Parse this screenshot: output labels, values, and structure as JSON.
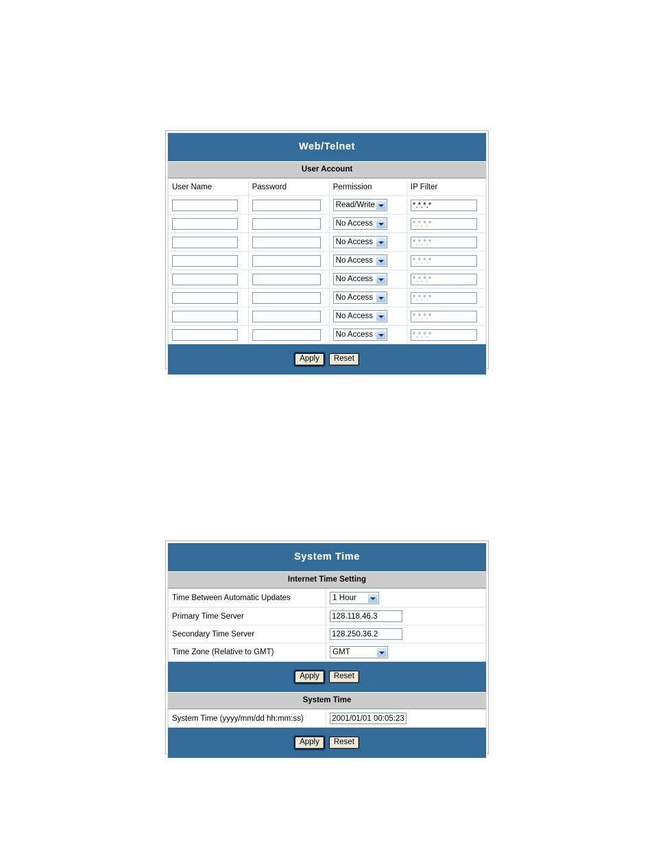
{
  "web_telnet": {
    "title": "Web/Telnet",
    "section": "User Account",
    "columns": [
      "User Name",
      "Password",
      "Permission",
      "IP Filter"
    ],
    "rows": [
      {
        "user": "",
        "password": "",
        "permission": "Read/Write",
        "ip_filter": "*.*.*.*",
        "disabled": false
      },
      {
        "user": "",
        "password": "",
        "permission": "No Access",
        "ip_filter": "*.*.*.*",
        "disabled": true
      },
      {
        "user": "",
        "password": "",
        "permission": "No Access",
        "ip_filter": "*.*.*.*",
        "disabled": true
      },
      {
        "user": "",
        "password": "",
        "permission": "No Access",
        "ip_filter": "*.*.*.*",
        "disabled": true
      },
      {
        "user": "",
        "password": "",
        "permission": "No Access",
        "ip_filter": "*.*.*.*",
        "disabled": true
      },
      {
        "user": "",
        "password": "",
        "permission": "No Access",
        "ip_filter": "*.*.*.*",
        "disabled": true
      },
      {
        "user": "",
        "password": "",
        "permission": "No Access",
        "ip_filter": "*.*.*.*",
        "disabled": true
      },
      {
        "user": "",
        "password": "",
        "permission": "No Access",
        "ip_filter": "*.*.*.*",
        "disabled": true
      }
    ],
    "apply_label": "Apply",
    "reset_label": "Reset"
  },
  "system_time": {
    "title": "System Time",
    "internet_section": "Internet Time Setting",
    "fields": {
      "updates_label": "Time Between Automatic Updates",
      "updates_value": "1 Hour",
      "primary_label": "Primary Time Server",
      "primary_value": "128.118.46.3",
      "secondary_label": "Secondary Time Server",
      "secondary_value": "128.250.36.2",
      "timezone_label": "Time Zone (Relative to GMT)",
      "timezone_value": "GMT"
    },
    "apply_label": "Apply",
    "reset_label": "Reset",
    "time_section": "System Time",
    "time_field": {
      "label": "System Time (yyyy/mm/dd hh:mm:ss)",
      "value": "2001/01/01 00:05:23"
    },
    "apply_label2": "Apply",
    "reset_label2": "Reset"
  },
  "colors": {
    "header_blue": "#336b99",
    "section_gray": "#cccccc",
    "grid_line": "#dbe3ec",
    "input_border": "#7c9cb5",
    "disabled_text": "#9b9681"
  }
}
